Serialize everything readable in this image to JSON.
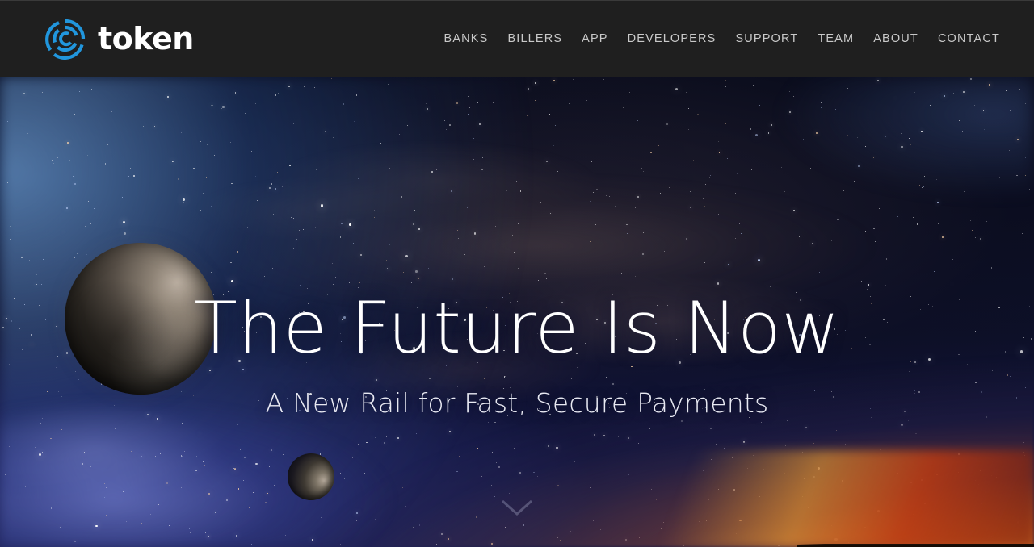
{
  "header": {
    "logo": {
      "icon": "token-concentric-arcs-icon",
      "wordmark": "token",
      "accent_color": "#2196dd"
    },
    "background_color": "#1f1f1f",
    "nav": [
      {
        "label": "BANKS"
      },
      {
        "label": "BILLERS"
      },
      {
        "label": "APP"
      },
      {
        "label": "DEVELOPERS"
      },
      {
        "label": "SUPPORT"
      },
      {
        "label": "TEAM"
      },
      {
        "label": "ABOUT"
      },
      {
        "label": "CONTACT"
      }
    ],
    "nav_text_color": "#c9c9c9"
  },
  "hero": {
    "title": "The Future Is Now",
    "subtitle": "A New Rail for Fast, Secure Payments",
    "title_color": "#ffffff",
    "subtitle_color": "#e8e9f2",
    "scroll_cue_icon": "chevron-down-icon",
    "background": {
      "scene": "starfield-space-with-moons-and-sunrise",
      "sky_color": "#0a0d20",
      "sunrise_color": "#ff9628",
      "nebula_blue": "#82b9f0",
      "nebula_violet": "#969ff5"
    },
    "objects": [
      {
        "name": "large-moon"
      },
      {
        "name": "small-moon"
      }
    ]
  }
}
